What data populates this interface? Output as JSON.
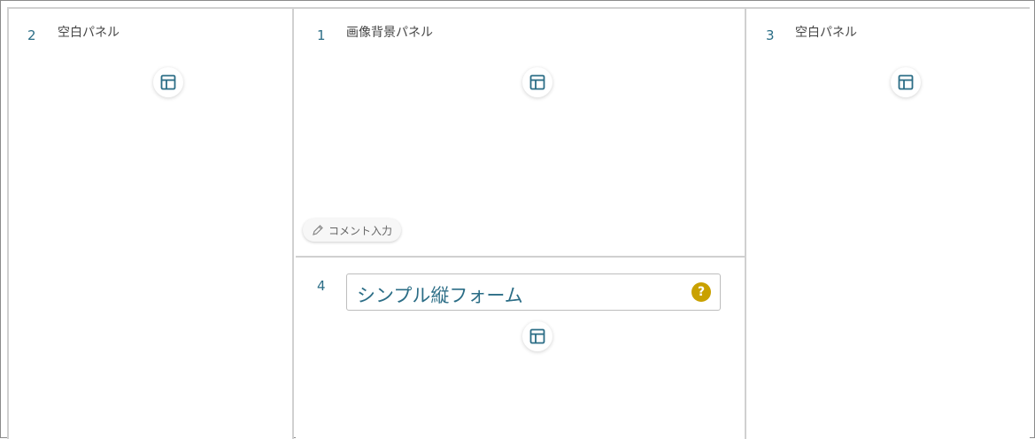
{
  "panels": {
    "left": {
      "number": "2",
      "title": "空白パネル"
    },
    "middle_top": {
      "number": "1",
      "title": "画像背景パネル",
      "comment_button": "コメント入力"
    },
    "middle_bottom": {
      "number": "4",
      "form_title": "シンプル縦フォーム",
      "help": "?"
    },
    "right": {
      "number": "3",
      "title": "空白パネル"
    }
  },
  "icons": {
    "layout": "layout-icon",
    "comment": "pencil-icon",
    "help": "question-icon"
  },
  "colors": {
    "accent": "#2b6d86",
    "help_badge": "#c9a100",
    "divider": "#d0d0d0"
  }
}
